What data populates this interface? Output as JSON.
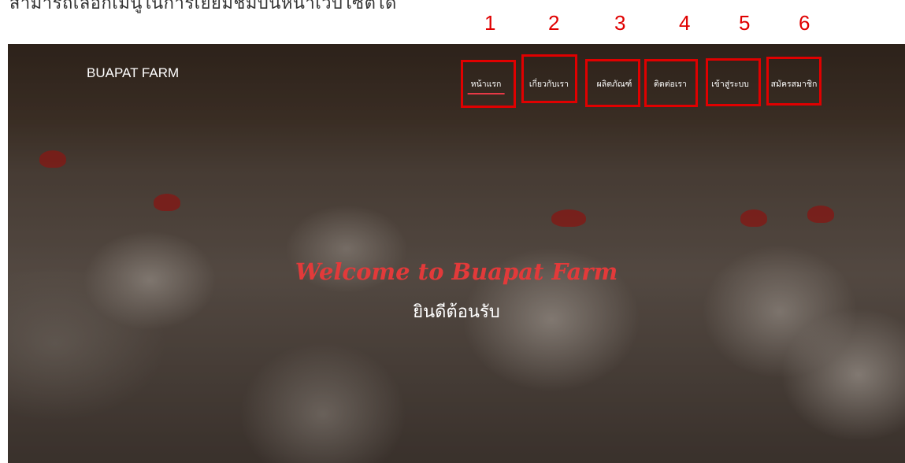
{
  "caption": "สามารถเลือกเมนูในการเยี่ยมชมบนหน้าเว็บไซต์ได้",
  "callout_numbers": [
    "1",
    "2",
    "3",
    "4",
    "5",
    "6"
  ],
  "header": {
    "brand": "BUAPAT FARM",
    "nav": [
      {
        "label": "หน้าแรก",
        "active": true
      },
      {
        "label": "เกี่ยวกับเรา",
        "active": false
      },
      {
        "label": "ผลิตภัณฑ์",
        "active": false
      },
      {
        "label": "ติดต่อเรา",
        "active": false
      },
      {
        "label": "เข้าสู่ระบบ",
        "active": false
      },
      {
        "label": "สมัครสมาชิก",
        "active": false
      }
    ]
  },
  "hero": {
    "title": "Welcome to Buapat Farm",
    "subtitle": "ยินดีต้อนรับ"
  },
  "colors": {
    "accent": "#e63946",
    "callout": "#e00000",
    "title": "#e23a3a"
  }
}
